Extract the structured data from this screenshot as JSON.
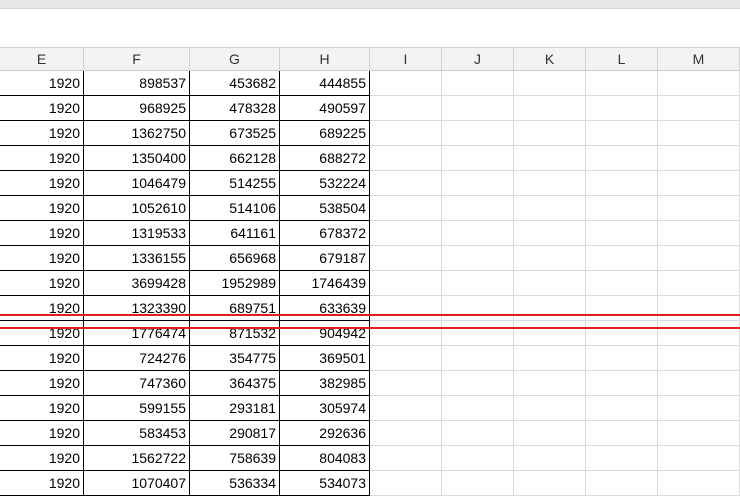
{
  "columns": [
    "E",
    "F",
    "G",
    "H",
    "I",
    "J",
    "K",
    "L",
    "M"
  ],
  "rows": [
    [
      "1920",
      "898537",
      "453682",
      "444855"
    ],
    [
      "1920",
      "968925",
      "478328",
      "490597"
    ],
    [
      "1920",
      "1362750",
      "673525",
      "689225"
    ],
    [
      "1920",
      "1350400",
      "662128",
      "688272"
    ],
    [
      "1920",
      "1046479",
      "514255",
      "532224"
    ],
    [
      "1920",
      "1052610",
      "514106",
      "538504"
    ],
    [
      "1920",
      "1319533",
      "641161",
      "678372"
    ],
    [
      "1920",
      "1336155",
      "656968",
      "679187"
    ],
    [
      "1920",
      "3699428",
      "1952989",
      "1746439"
    ],
    [
      "1920",
      "1323390",
      "689751",
      "633639"
    ],
    [
      "1920",
      "1776474",
      "871532",
      "904942"
    ],
    [
      "1920",
      "724276",
      "354775",
      "369501"
    ],
    [
      "1920",
      "747360",
      "364375",
      "382985"
    ],
    [
      "1920",
      "599155",
      "293181",
      "305974"
    ],
    [
      "1920",
      "583453",
      "290817",
      "292636"
    ],
    [
      "1920",
      "1562722",
      "758639",
      "804083"
    ],
    [
      "1920",
      "1070407",
      "536334",
      "534073"
    ]
  ],
  "colors": {
    "header_bg": "#f3f3f3",
    "gridline": "#dadada",
    "cell_border": "#000000",
    "annotation_line": "#e01e1e"
  }
}
